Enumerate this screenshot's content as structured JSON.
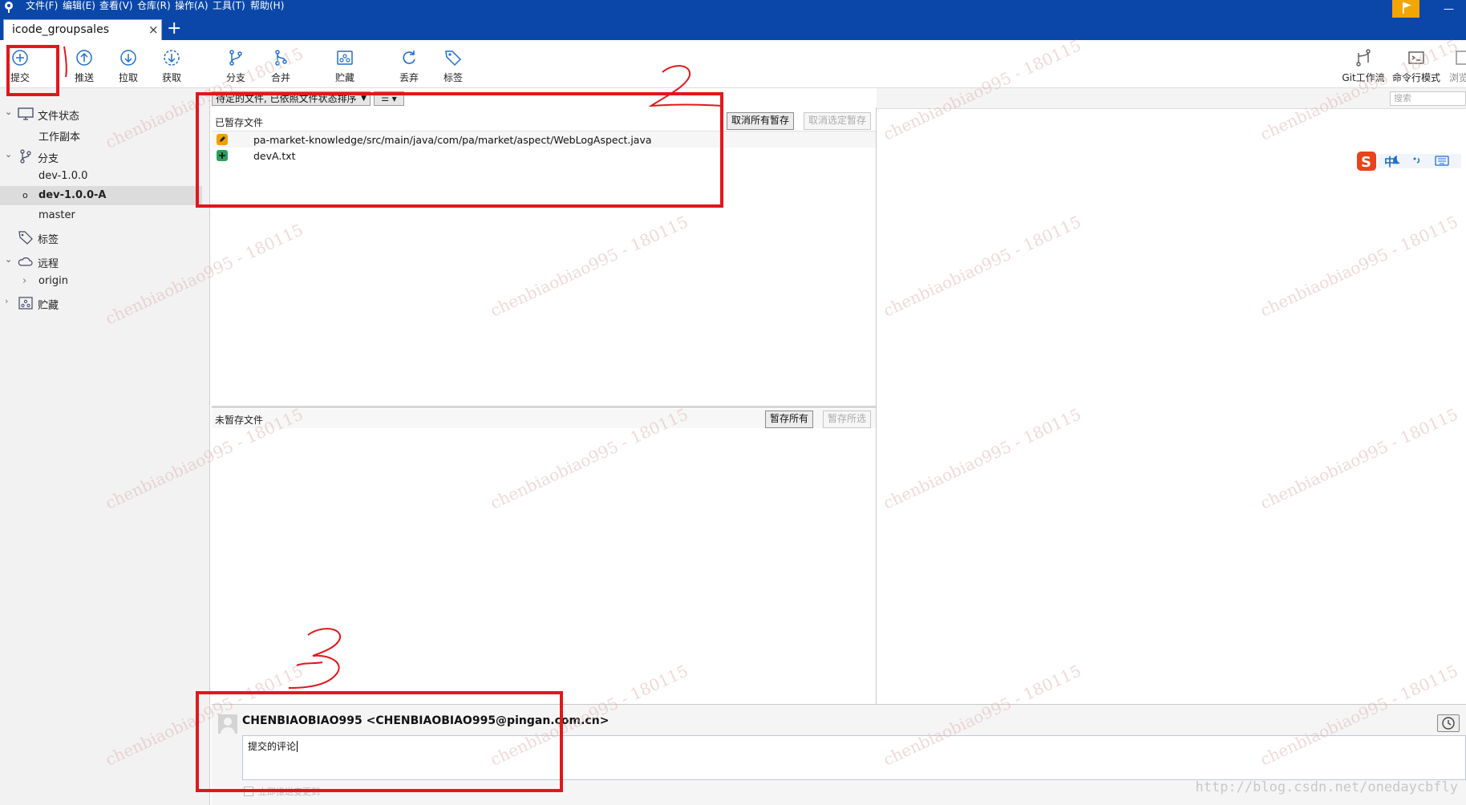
{
  "menu": {
    "items": [
      "文件(F)",
      "编辑(E)",
      "查看(V)",
      "仓库(R)",
      "操作(A)",
      "工具(T)",
      "帮助(H)"
    ]
  },
  "tab": {
    "title": "icode_groupsales",
    "close": "×",
    "add": "+"
  },
  "toolbar": {
    "left": [
      {
        "label": "提交",
        "icon": "commit-icon"
      },
      {
        "label": "推送",
        "icon": "push-icon"
      },
      {
        "label": "拉取",
        "icon": "pull-icon"
      },
      {
        "label": "获取",
        "icon": "fetch-icon"
      },
      {
        "label": "分支",
        "icon": "branch-icon"
      },
      {
        "label": "合并",
        "icon": "merge-icon"
      },
      {
        "label": "贮藏",
        "icon": "stash-icon"
      },
      {
        "label": "丢弃",
        "icon": "discard-icon"
      },
      {
        "label": "标签",
        "icon": "tag-icon"
      }
    ],
    "right": [
      {
        "label": "Git工作流",
        "icon": "git-flow-icon"
      },
      {
        "label": "命令行模式",
        "icon": "terminal-icon"
      },
      {
        "label": "浏览",
        "icon": "explorer-icon"
      }
    ]
  },
  "sidebar": {
    "file_status": {
      "label": "文件状态",
      "items": [
        "工作副本"
      ]
    },
    "branches": {
      "label": "分支",
      "items": [
        {
          "name": "dev-1.0.0",
          "current": false
        },
        {
          "name": "dev-1.0.0-A",
          "current": true
        },
        {
          "name": "master",
          "current": false
        }
      ]
    },
    "tags": {
      "label": "标签"
    },
    "remotes": {
      "label": "远程",
      "items": [
        "origin"
      ]
    },
    "stashes": {
      "label": "贮藏"
    }
  },
  "staging": {
    "sort_option": "待定的文件, 已依照文件状态排序",
    "view_option": "☰",
    "staged_title": "已暂存文件",
    "unstage_all": "取消所有暂存",
    "unstage_selected": "取消选定暂存",
    "staged_files": [
      {
        "path": "pa-market-knowledge/src/main/java/com/pa/market/aspect/WebLogAspect.java",
        "status": "modified",
        "color": "#f0a000"
      },
      {
        "path": "devA.txt",
        "status": "added",
        "color": "#2e9e5e"
      }
    ],
    "unstaged_title": "未暂存文件",
    "stage_all": "暂存所有",
    "stage_selected": "暂存所选"
  },
  "diff": {
    "search_placeholder": "搜索"
  },
  "ime": {
    "mode": "中",
    "icon": "sogou-ime-icon"
  },
  "commit": {
    "author": "CHENBIAOBIAO995 <CHENBIAOBIAO995@pingan.com.cn>",
    "message": "提交的评论",
    "amend_label": "立即推送变更到"
  },
  "annotations": {
    "mark1": "1",
    "mark2": "2",
    "mark3": "3",
    "watermark": "chenbiaobiao995 - 180115",
    "url": "http://blog.csdn.net/onedaycbfly",
    "color": "#e3161c"
  }
}
